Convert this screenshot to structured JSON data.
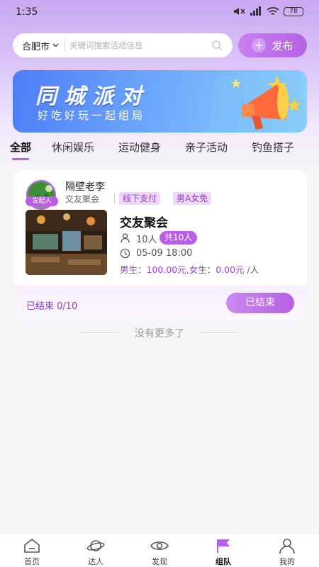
{
  "status_bar": {
    "time": "1:35",
    "battery": "78"
  },
  "header": {
    "city": "合肥市",
    "search_placeholder": "关键词搜索活动信息",
    "publish_label": "发布"
  },
  "banner": {
    "title": "同城派对",
    "subtitle": "好吃好玩一起组局"
  },
  "tabs": [
    {
      "label": "全部"
    },
    {
      "label": "休闲娱乐"
    },
    {
      "label": "运动健身"
    },
    {
      "label": "亲子活动"
    },
    {
      "label": "钓鱼搭子"
    }
  ],
  "event": {
    "host_badge": "发起人",
    "host_name": "隔壁老李",
    "category": "交友聚会",
    "tags": [
      "线下支付",
      "男A女免"
    ],
    "title": "交友聚会",
    "people": "10人",
    "total": "共10人",
    "time": "05-09 18:00",
    "price": "男生：100.00元,女生：0.00元",
    "price_unit": "/人",
    "footer_status": "已结束 0/10",
    "button_label": "已结束"
  },
  "list_end_text": "没有更多了",
  "bottom_nav": [
    {
      "label": "首页",
      "icon": "home-icon"
    },
    {
      "label": "达人",
      "icon": "planet-icon"
    },
    {
      "label": "发现",
      "icon": "eye-icon"
    },
    {
      "label": "组队",
      "icon": "flag-icon"
    },
    {
      "label": "我的",
      "icon": "person-icon"
    }
  ],
  "colors": {
    "accent": "#b760e6",
    "banner_blue": "#4e7df7"
  }
}
